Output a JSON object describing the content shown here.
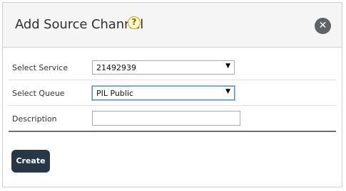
{
  "dialog": {
    "title": "Add Source Channel",
    "help_icon": "help-icon",
    "help_glyph": "?",
    "close_icon": "close-icon",
    "close_glyph": "✕"
  },
  "form": {
    "service": {
      "label": "Select Service",
      "value": "21492939"
    },
    "queue": {
      "label": "Select Queue",
      "value": "PIL Public"
    },
    "description": {
      "label": "Description",
      "value": "",
      "placeholder": ""
    }
  },
  "actions": {
    "create_label": "Create"
  },
  "colors": {
    "header_bg": "#f5f5f5",
    "button_bg": "#263745",
    "close_bg": "#5f6366",
    "help_bg": "#fff8c8"
  }
}
